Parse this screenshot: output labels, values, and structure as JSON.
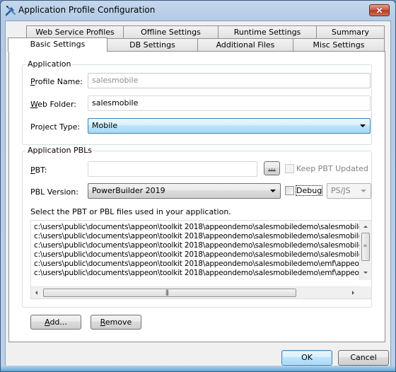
{
  "window": {
    "title": "Application Profile Configuration",
    "icon": "tools-icon",
    "close_label": "✕"
  },
  "tabs": {
    "row_back": [
      {
        "label": "Web Service Profiles"
      },
      {
        "label": "Offline Settings"
      },
      {
        "label": "Runtime Settings"
      },
      {
        "label": "Summary"
      }
    ],
    "row_front": [
      {
        "label": "Basic Settings",
        "active": true
      },
      {
        "label": "DB Settings"
      },
      {
        "label": "Additional Files"
      },
      {
        "label": "Misc Settings"
      }
    ]
  },
  "application": {
    "group_title": "Application",
    "profile_name": {
      "label": "Profile Name:",
      "mnemonic": "P",
      "value": "salesmobile"
    },
    "web_folder": {
      "label": "Web Folder:",
      "mnemonic": "W",
      "value": "salesmobile"
    },
    "project_type": {
      "label": "Project Type:",
      "value": "Mobile"
    }
  },
  "pbls": {
    "group_title": "Application PBLs",
    "pbt": {
      "label": "PBT:",
      "mnemonic": "P",
      "value": "",
      "browse_label": "..."
    },
    "keep_pbt_updated": {
      "label": "Keep PBT Updated",
      "checked": false,
      "enabled": false
    },
    "pbl_version": {
      "label": "PBL Version:",
      "value": "PowerBuilder 2019"
    },
    "debug": {
      "label": "Debug",
      "checked": false
    },
    "script_type": {
      "value": "PS/JS",
      "enabled": false
    },
    "instructions": "Select the PBT or PBL files used in your application.",
    "files": [
      "c:\\users\\public\\documents\\appeon\\toolkit 2018\\appeondemo\\salesmobiledemo\\salesmobile\\sal",
      "c:\\users\\public\\documents\\appeon\\toolkit 2018\\appeondemo\\salesmobiledemo\\salesmobile\\sal",
      "c:\\users\\public\\documents\\appeon\\toolkit 2018\\appeondemo\\salesmobiledemo\\salesmobile\\sal",
      "c:\\users\\public\\documents\\appeon\\toolkit 2018\\appeondemo\\salesmobiledemo\\salesmobile\\sal",
      "c:\\users\\public\\documents\\appeon\\toolkit 2018\\appeondemo\\salesmobiledemo\\emf\\appeon_m",
      "c:\\users\\public\\documents\\appeon\\toolkit 2018\\appeondemo\\salesmobiledemo\\emf\\appeon_w"
    ],
    "add_label": "Add...",
    "remove_label": "Remove"
  },
  "footer": {
    "ok_label": "OK",
    "cancel_label": "Cancel"
  }
}
